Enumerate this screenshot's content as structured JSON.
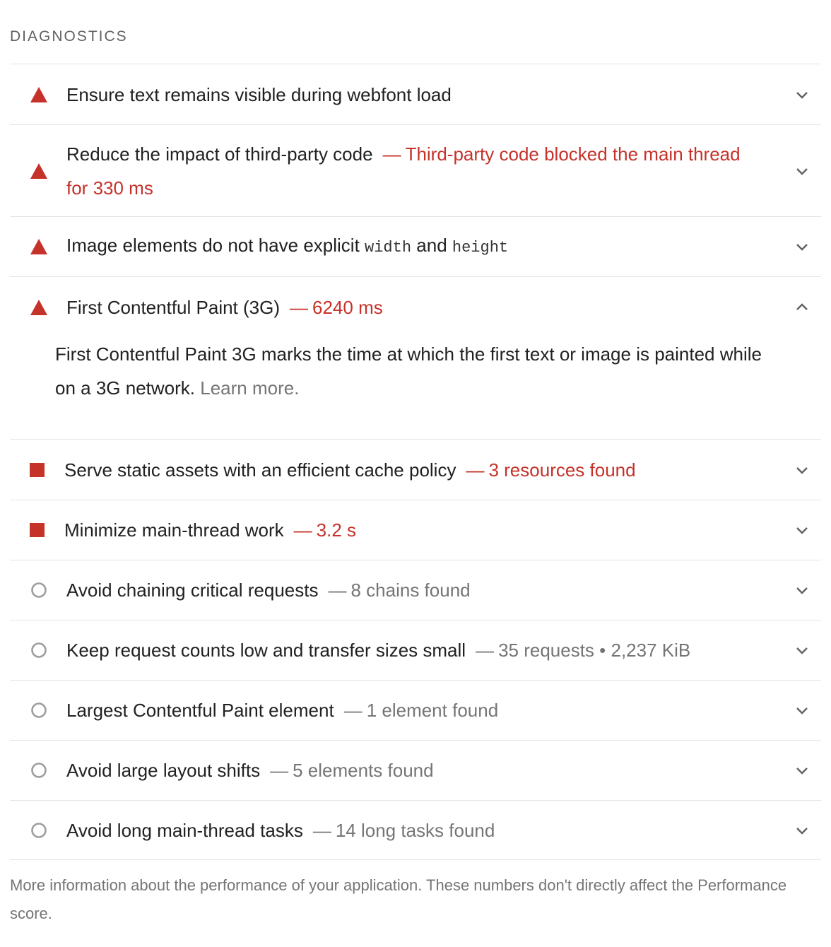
{
  "section": {
    "title": "DIAGNOSTICS"
  },
  "audits": [
    {
      "status": "fail",
      "title": "Ensure text remains visible during webfont load",
      "display": "",
      "expanded": false
    },
    {
      "status": "fail",
      "title": "Reduce the impact of third-party code",
      "display": "Third-party code blocked the main thread for 330 ms",
      "expanded": false
    },
    {
      "status": "fail",
      "title_parts": [
        "Image elements do not have explicit",
        "width",
        "and",
        "height"
      ],
      "display": "",
      "expanded": false
    },
    {
      "status": "fail",
      "title": "First Contentful Paint (3G)",
      "display": "6240 ms",
      "expanded": true,
      "description": "First Contentful Paint 3G marks the time at which the first text or image is painted while on a 3G network.",
      "link_text": "Learn more"
    },
    {
      "status": "average",
      "title": "Serve static assets with an efficient cache policy",
      "display": "3 resources found",
      "expanded": false
    },
    {
      "status": "average",
      "title": "Minimize main-thread work",
      "display": "3.2 s",
      "expanded": false
    },
    {
      "status": "info",
      "title": "Avoid chaining critical requests",
      "display": "8 chains found",
      "expanded": false
    },
    {
      "status": "info",
      "title": "Keep request counts low and transfer sizes small",
      "display": "35 requests • 2,237 KiB",
      "expanded": false
    },
    {
      "status": "info",
      "title": "Largest Contentful Paint element",
      "display": "1 element found",
      "expanded": false
    },
    {
      "status": "info",
      "title": "Avoid large layout shifts",
      "display": "5 elements found",
      "expanded": false
    },
    {
      "status": "info",
      "title": "Avoid long main-thread tasks",
      "display": "14 long tasks found",
      "expanded": false
    }
  ],
  "separator": "—",
  "footer": "More information about the performance of your application. These numbers don't directly affect the Performance score.",
  "colors": {
    "fail": "#c5322a",
    "average": "#c5322a",
    "info_icon": "#9e9e9e",
    "info_text": "#757575",
    "divider": "#e3e3e3"
  },
  "icons": {
    "fail": "triangle-icon",
    "average": "square-icon",
    "info": "circle-icon",
    "collapsed": "chevron-down-icon",
    "expanded": "chevron-up-icon"
  }
}
